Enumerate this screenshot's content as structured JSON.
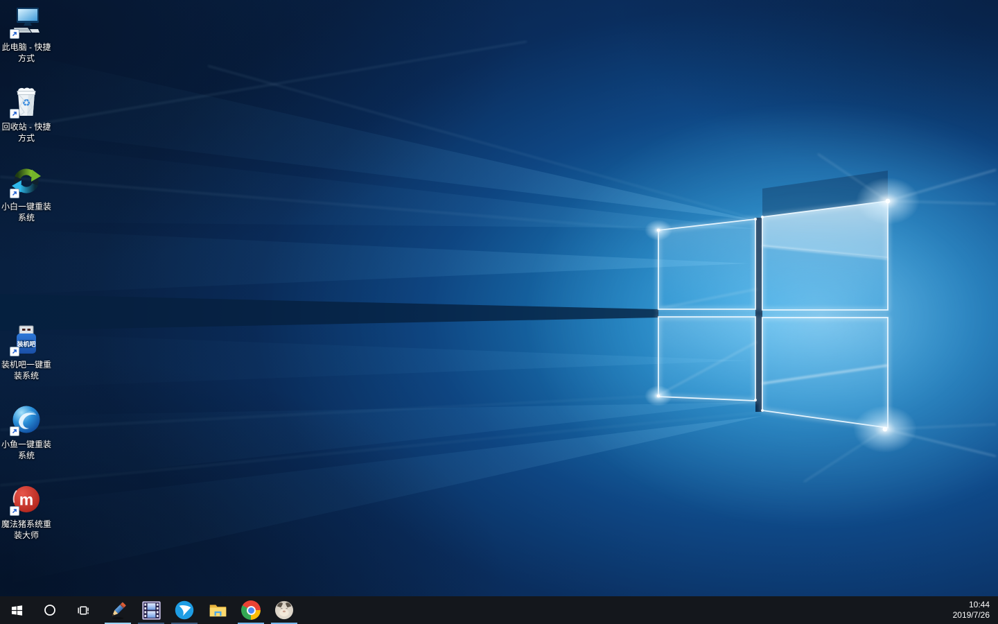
{
  "os": {
    "name": "Windows 10 desktop"
  },
  "desktop": {
    "icons": [
      {
        "name": "this-pc-shortcut",
        "icon": "computer-icon",
        "label": "此电脑 - 快捷方式"
      },
      {
        "name": "recycle-bin-shortcut",
        "icon": "recycle-bin-icon",
        "label": "回收站 - 快捷方式"
      },
      {
        "name": "xiaobai-reinstall",
        "icon": "sync-arrows-icon",
        "label": "小白一键重装系统"
      },
      {
        "name": "zhuangjiba-reinstall",
        "icon": "blue-usb-drive-icon",
        "label": "装机吧一键重装系统"
      },
      {
        "name": "xiaoyu-reinstall",
        "icon": "blue-wave-sphere-icon",
        "label": "小鱼一键重装系统"
      },
      {
        "name": "mofazhu-reinstall",
        "icon": "red-m-circle-icon",
        "label": "魔法猪系统重装大师"
      }
    ],
    "usb_label": "装机吧"
  },
  "taskbar": {
    "system_buttons": [
      {
        "name": "start",
        "icon": "windows-logo-icon"
      },
      {
        "name": "search",
        "icon": "cortana-circle-icon"
      },
      {
        "name": "task-view",
        "icon": "task-view-icon"
      }
    ],
    "apps": [
      {
        "name": "pencil-app",
        "icon": "pencil-icon",
        "running": true,
        "active": true
      },
      {
        "name": "movie-app",
        "icon": "film-strip-icon",
        "running": true,
        "active": false
      },
      {
        "name": "wing-app",
        "icon": "blue-wing-icon",
        "running": true,
        "active": false
      },
      {
        "name": "file-explorer",
        "icon": "folder-icon",
        "running": false,
        "active": false
      },
      {
        "name": "chrome-browser",
        "icon": "chrome-icon",
        "running": true,
        "active": false
      },
      {
        "name": "chat-avatar-app",
        "icon": "cat-avatar-icon",
        "running": true,
        "active": false
      }
    ],
    "clock": {
      "time": "10:44",
      "date": "2019/7/26"
    }
  },
  "colors": {
    "taskbar_bg": "#14171c",
    "underline_active": "#9bd4f7",
    "underline_dim": "#3a5a7d",
    "wallpaper_accent": "#2fa7e6"
  }
}
